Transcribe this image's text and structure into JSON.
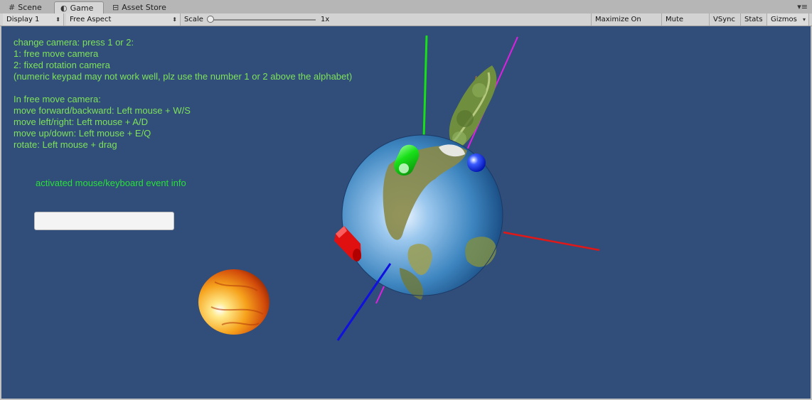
{
  "tabs": [
    {
      "label": "Scene",
      "icon": "grid-icon"
    },
    {
      "label": "Game",
      "icon": "pacman-icon"
    },
    {
      "label": "Asset Store",
      "icon": "bag-icon"
    }
  ],
  "toolbar": {
    "display": "Display 1",
    "aspect": "Free Aspect",
    "scale_label": "Scale",
    "scale_value": "1x",
    "maximize": "Maximize On Play",
    "mute": "Mute Audio",
    "vsync": "VSync",
    "stats": "Stats",
    "gizmos": "Gizmos"
  },
  "overlay": {
    "instructions": "change camera: press 1 or 2:\n1: free move camera\n2: fixed rotation camera\n(numeric keypad may not work well, plz use the number 1 or 2 above the alphabet)\n\nIn free move camera:\nmove forward/backward: Left mouse + W/S\nmove left/right: Left mouse + A/D\nmove up/down: Left mouse + E/Q\nrotate: Left mouse + drag",
    "event_label": "activated mouse/keyboard event info",
    "event_value": ""
  },
  "colors": {
    "game_bg": "#314d79",
    "instruction_text": "#7ee35a",
    "event_text": "#29e03a"
  }
}
